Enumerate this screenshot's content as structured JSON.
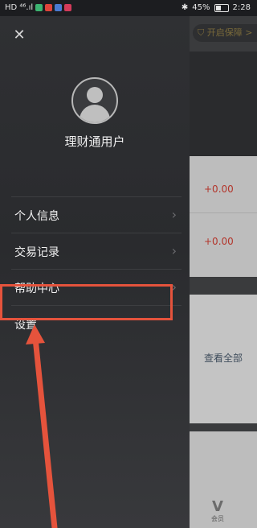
{
  "status_bar": {
    "left_indicators": "HD ⁴⁶.ıl",
    "battery_percent": "45%",
    "time": "2:28"
  },
  "background_page": {
    "protect_button": "开启保障 >",
    "amounts": [
      "+0.00",
      "+0.00"
    ],
    "view_all": "查看全部",
    "bottom_tab_label": "会员"
  },
  "drawer": {
    "username": "理财通用户",
    "menu": [
      {
        "label": "个人信息"
      },
      {
        "label": "交易记录"
      },
      {
        "label": "帮助中心"
      },
      {
        "label": "设置"
      }
    ]
  },
  "colors": {
    "highlight": "#e5533c",
    "amount": "#b3352b"
  }
}
